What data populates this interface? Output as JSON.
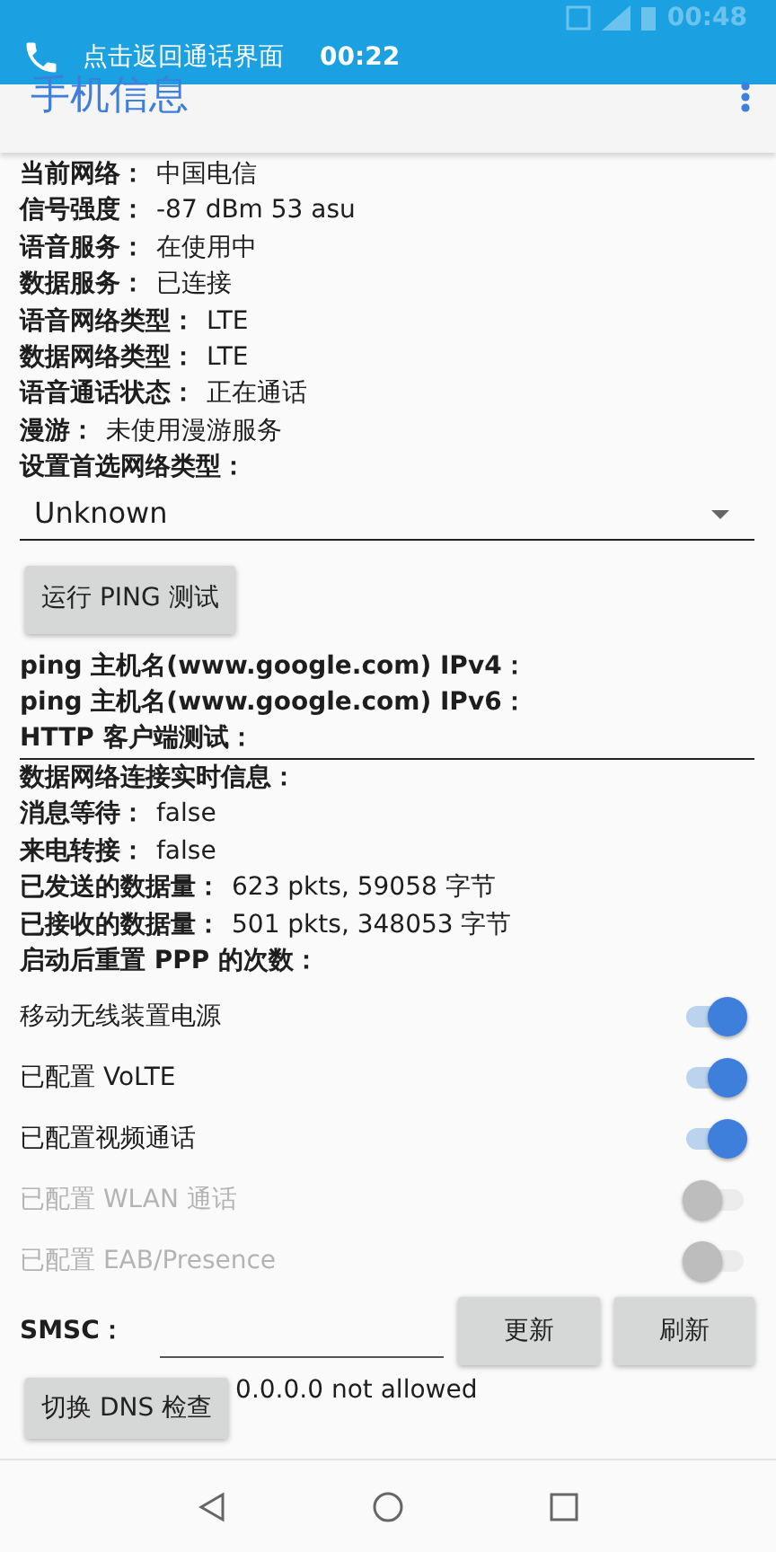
{
  "status_bar": {
    "call_banner": "点击返回通话界面",
    "call_timer": "00:22",
    "clock": "00:48"
  },
  "app_bar": {
    "title": "手机信息"
  },
  "info_rows": [
    {
      "label": "当前网络：",
      "value": "中国电信"
    },
    {
      "label": "信号强度：",
      "value": "-87 dBm   53 asu"
    },
    {
      "label": "语音服务：",
      "value": "在使用中"
    },
    {
      "label": "数据服务：",
      "value": "已连接"
    },
    {
      "label": "语音网络类型：",
      "value": "LTE"
    },
    {
      "label": "数据网络类型：",
      "value": "LTE"
    },
    {
      "label": "语音通话状态：",
      "value": "正在通话"
    },
    {
      "label": "漫游：",
      "value": "未使用漫游服务"
    }
  ],
  "preferred_network": {
    "label": "设置首选网络类型：",
    "value": "Unknown"
  },
  "ping_button": "运行 PING 测试",
  "ping_results": [
    "ping 主机名(www.google.com) IPv4：",
    "ping 主机名(www.google.com) IPv6：",
    "HTTP 客户端测试："
  ],
  "realtime": {
    "title": "数据网络连接实时信息：",
    "rows": [
      {
        "label": "消息等待：",
        "value": "false"
      },
      {
        "label": "来电转接：",
        "value": "false"
      },
      {
        "label": "已发送的数据量：",
        "value": "623 pkts, 59058 字节"
      },
      {
        "label": "已接收的数据量：",
        "value": "501 pkts, 348053 字节"
      },
      {
        "label": "启动后重置 PPP 的次数："
      }
    ]
  },
  "switches": [
    {
      "label": "移动无线装置电源",
      "on": true,
      "disabled": false
    },
    {
      "label": "已配置 VoLTE",
      "on": true,
      "disabled": false
    },
    {
      "label": "已配置视频通话",
      "on": true,
      "disabled": false
    },
    {
      "label": "已配置 WLAN 通话",
      "on": false,
      "disabled": true
    },
    {
      "label": "已配置 EAB/Presence",
      "on": false,
      "disabled": true
    }
  ],
  "smsc": {
    "label": "SMSC：",
    "buttons": [
      "更新",
      "刷新"
    ]
  },
  "dns": {
    "button": "切换 DNS 检查",
    "status": "0.0.0.0 not allowed"
  }
}
